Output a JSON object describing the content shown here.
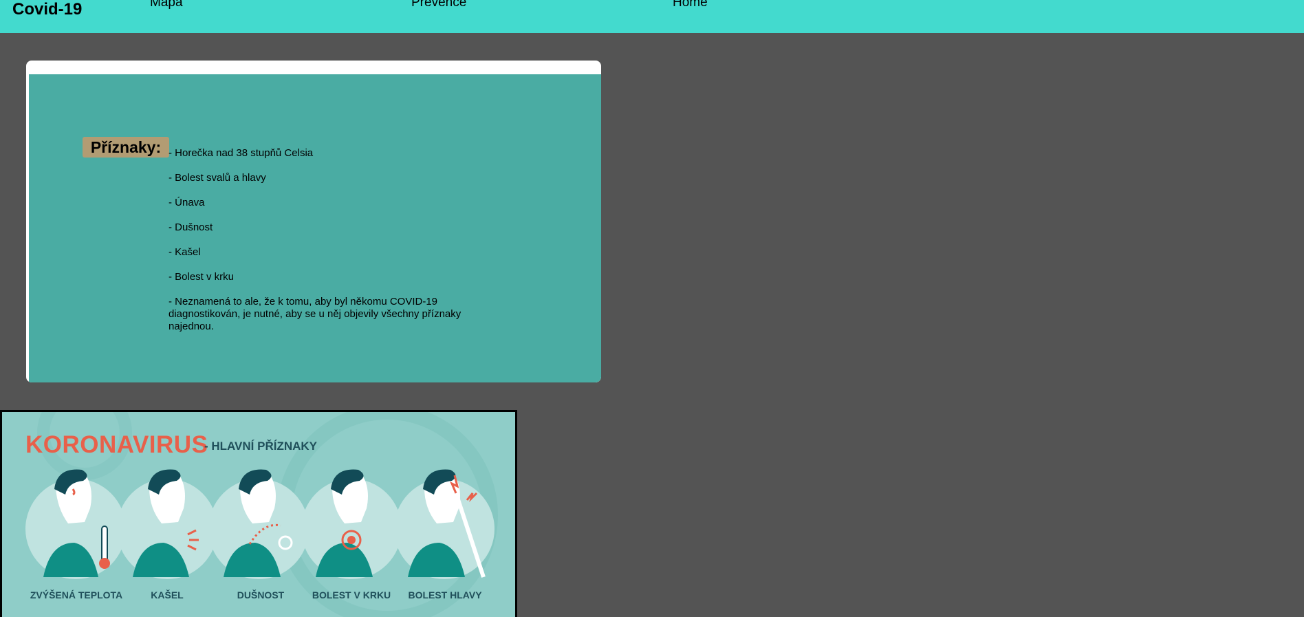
{
  "header": {
    "brand": "Covid-19",
    "nav": [
      "Mapa",
      "Prevence",
      "Home"
    ]
  },
  "card": {
    "badge": "Příznaky:",
    "symptoms": [
      "- Horečka nad 38 stupňů Celsia",
      "- Bolest svalů a hlavy",
      "- Únava",
      "- Dušnost",
      "- Kašel",
      "- Bolest v krku",
      "- Neznamená to ale, že k tomu, aby byl někomu COVID-19 diagnostikován, je nutné, aby se u něj objevily všechny příznaky najednou."
    ]
  },
  "infographic": {
    "title": "KORONAVIRUS",
    "subtitle": "- HLAVNÍ PŘÍZNAKY",
    "captions": [
      "ZVÝŠENÁ TEPLOTA",
      "KAŠEL",
      "DUŠNOST",
      "BOLEST V KRKU",
      "BOLEST HLAVY"
    ],
    "icons": [
      "fever-icon",
      "cough-icon",
      "shortness-of-breath-icon",
      "sore-throat-icon",
      "headache-icon"
    ]
  },
  "colors": {
    "topbar": "#43dace",
    "background": "#545454",
    "card_inner": "#4aaca3",
    "badge": "#b29c73",
    "info_title": "#e8604a"
  }
}
